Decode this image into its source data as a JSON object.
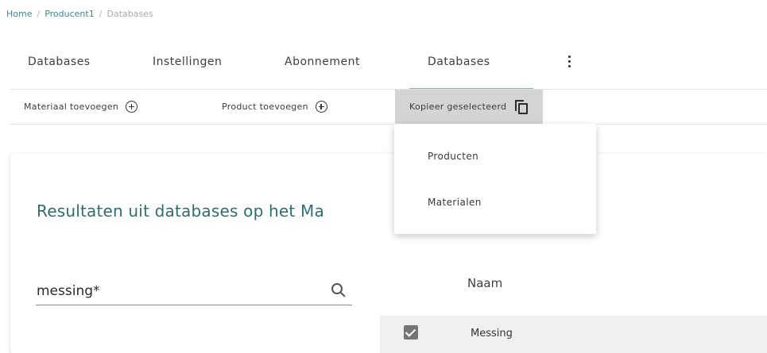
{
  "breadcrumb": {
    "home": "Home",
    "sep1": "/",
    "producer": "Producent1",
    "sep2": "/",
    "current": "Databases"
  },
  "tabs": [
    {
      "label": "Databases"
    },
    {
      "label": "Instellingen"
    },
    {
      "label": "Abonnement"
    },
    {
      "label": "Databases"
    }
  ],
  "more_icon": "more-vert-icon",
  "toolbar": {
    "add_material": "Materiaal toevoegen",
    "add_product": "Product toevoegen",
    "copy_selected": "Kopieer geselecteerd",
    "add_icon": "add-circle-icon",
    "copy_icon": "copy-icon"
  },
  "dropdown": {
    "items": [
      {
        "label": "Producten"
      },
      {
        "label": "Materialen"
      }
    ]
  },
  "card": {
    "title": "Resultaten uit databases op het Ma"
  },
  "search": {
    "value": "messing*",
    "icon": "search-icon"
  },
  "table": {
    "column_header": "Naam",
    "rows": [
      {
        "name": "Messing",
        "checked": true
      }
    ]
  },
  "colors": {
    "accent": "#3d8a8c",
    "title": "#2f6d70",
    "active_toolbar": "#d4d4d4",
    "row_bg": "#f0f0f0"
  }
}
